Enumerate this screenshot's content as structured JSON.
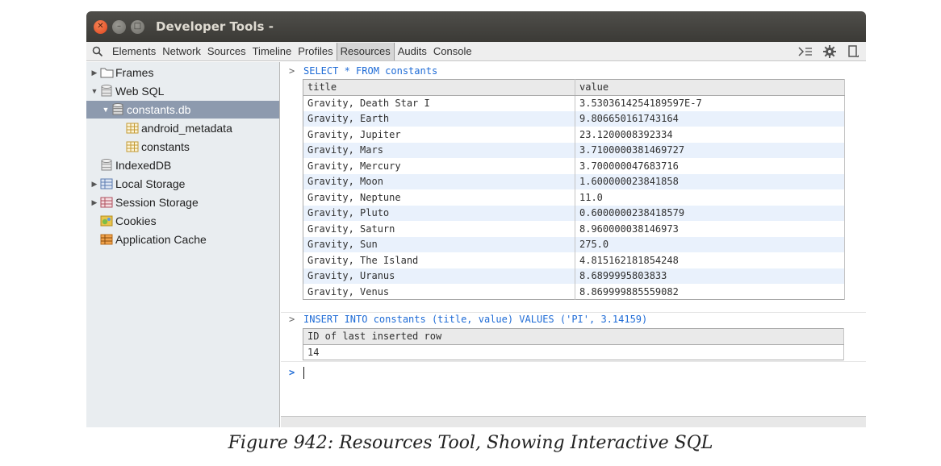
{
  "window": {
    "title": "Developer Tools -"
  },
  "toolbar": {
    "tabs": [
      "Elements",
      "Network",
      "Sources",
      "Timeline",
      "Profiles",
      "Resources",
      "Audits",
      "Console"
    ],
    "active_tab": "Resources"
  },
  "sidebar": {
    "frames": "Frames",
    "web_sql": "Web SQL",
    "database": "constants.db",
    "table1": "android_metadata",
    "table2": "constants",
    "indexeddb": "IndexedDB",
    "local_storage": "Local Storage",
    "session_storage": "Session Storage",
    "cookies": "Cookies",
    "app_cache": "Application Cache"
  },
  "console": {
    "query1": "SELECT * FROM constants",
    "result1": {
      "columns": [
        "title",
        "value"
      ],
      "rows": [
        [
          "Gravity, Death Star I",
          "3.5303614254189597E-7"
        ],
        [
          "Gravity, Earth",
          "9.806650161743164"
        ],
        [
          "Gravity, Jupiter",
          "23.1200008392334"
        ],
        [
          "Gravity, Mars",
          "3.7100000381469727"
        ],
        [
          "Gravity, Mercury",
          "3.700000047683716"
        ],
        [
          "Gravity, Moon",
          "1.600000023841858"
        ],
        [
          "Gravity, Neptune",
          "11.0"
        ],
        [
          "Gravity, Pluto",
          "0.6000000238418579"
        ],
        [
          "Gravity, Saturn",
          "8.960000038146973"
        ],
        [
          "Gravity, Sun",
          "275.0"
        ],
        [
          "Gravity, The Island",
          "4.815162181854248"
        ],
        [
          "Gravity, Uranus",
          "8.6899995803833"
        ],
        [
          "Gravity, Venus",
          "8.869999885559082"
        ]
      ]
    },
    "query2": "INSERT INTO constants (title, value) VALUES ('PI', 3.14159)",
    "result2": {
      "columns": [
        "ID of last inserted row"
      ],
      "rows": [
        [
          "14"
        ]
      ]
    }
  },
  "caption": "Figure 942: Resources Tool, Showing Interactive SQL"
}
